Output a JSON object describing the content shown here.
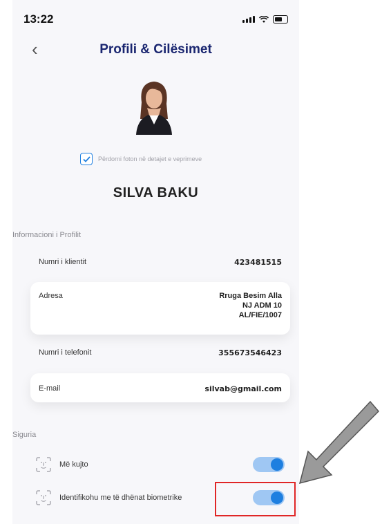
{
  "status_bar": {
    "time": "13:22"
  },
  "header": {
    "title": "Profili & Cilësimet"
  },
  "photo_option": {
    "label": "Përdorni foton në detajet e veprimeve",
    "checked": true
  },
  "profile_name": "SILVA BAKU",
  "profile_section": {
    "title": "Informacioni i Profilit",
    "fields": [
      {
        "label": "Numri i klientit",
        "value": "423481515"
      },
      {
        "label": "Adresa",
        "value": "Rruga Besim Alla\nNJ ADM 10\nAL/FIE/1007"
      },
      {
        "label": "Numri i telefonit",
        "value": "355673546423"
      },
      {
        "label": "E-mail",
        "value": "silvab@gmail.com"
      }
    ]
  },
  "security_section": {
    "title": "Siguria",
    "items": [
      {
        "label": "Më kujto",
        "enabled": true
      },
      {
        "label": "Identifikohu me të dhënat biometrike",
        "enabled": true
      }
    ]
  },
  "colors": {
    "accent": "#1e7fe0",
    "title": "#1a2670",
    "highlight": "#e02626",
    "arrow": "#9a9a9a"
  }
}
